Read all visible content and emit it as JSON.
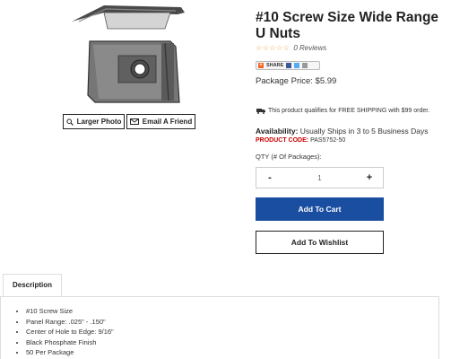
{
  "product": {
    "title": "#10 Screw Size Wide Range U Nuts",
    "stars": "☆☆☆☆☆",
    "reviews": "0 Reviews",
    "share_label": "SHARE",
    "package_price": "Package Price: $5.99",
    "shipping_note": "This product qualifies for FREE SHIPPING with $99 order.",
    "availability_label": "Availability:",
    "availability_value": "Usually Ships in 3 to 5 Business Days",
    "product_code_label": "PRODUCT CODE:",
    "product_code_value": "PAS5752-50",
    "qty_label": "QTY (# Of Packages):",
    "qty_minus": "-",
    "qty_plus": "+",
    "qty_value": "1",
    "add_to_cart": "Add To Cart",
    "add_to_wishlist": "Add To Wishlist"
  },
  "image_buttons": {
    "larger_photo": "Larger Photo",
    "email_friend": "Email A Friend"
  },
  "description": {
    "tab_label": "Description",
    "bullets": [
      "#10 Screw Size",
      "Panel Range: .025\" - .150\"",
      "Center of Hole to Edge: 9/16\"",
      "Black Phosphate Finish",
      "50 Per Package"
    ]
  },
  "colors": {
    "accent_button": "#1a4ea0",
    "product_code": "#cc0000",
    "stars": "#e8a33a"
  }
}
